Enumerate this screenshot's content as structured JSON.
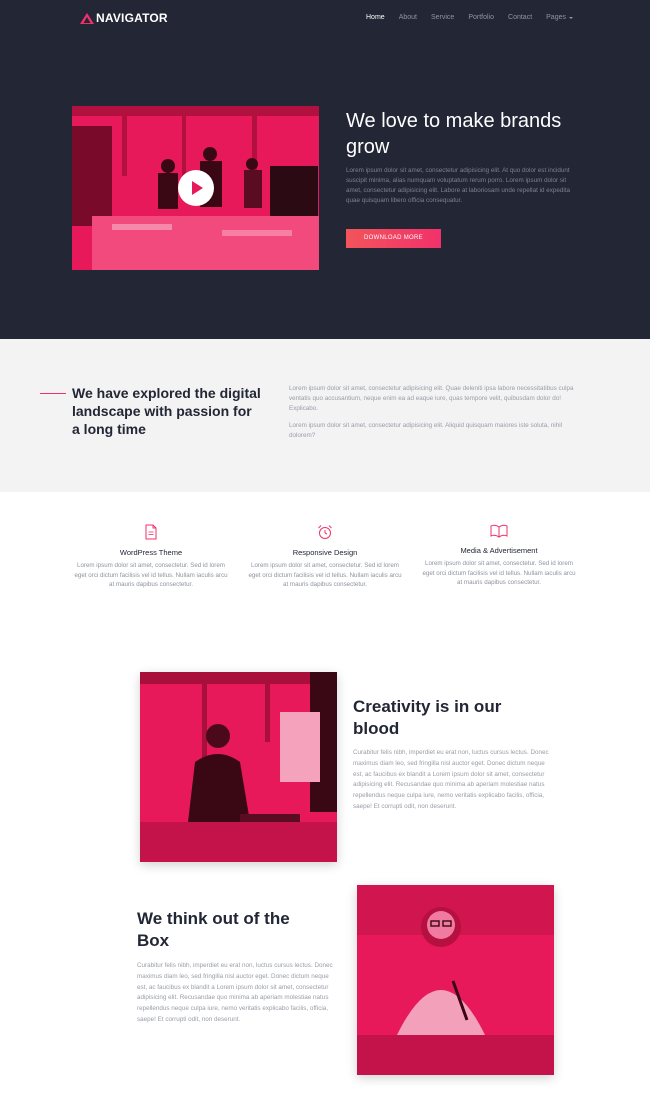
{
  "brand": {
    "name": "NAVIGATOR",
    "accent": "#f2316a",
    "dark_bg": "#222635"
  },
  "nav": {
    "items": [
      {
        "label": "Home",
        "active": true
      },
      {
        "label": "About",
        "active": false
      },
      {
        "label": "Service",
        "active": false
      },
      {
        "label": "Portfolio",
        "active": false
      },
      {
        "label": "Contact",
        "active": false
      },
      {
        "label": "Pages",
        "active": false,
        "has_dropdown": true
      }
    ]
  },
  "hero": {
    "title": "We love to make brands grow",
    "text": "Lorem ipsum dolor sit amet, consectetur adipisicing elit. At quo dolor est incidunt suscipit minima, alias numquam voluptatum rerum porro. Lorem ipsum dolor sit amet, consectetur adipisicing elit. Labore at laboriosam unde repellat id expedita quae quisquam libero officia consequatur.",
    "button": "DOWNLOAD MORE"
  },
  "explore": {
    "title": "We have explored the digital landscape with passion for a long time",
    "paragraphs": [
      "Lorem ipsum dolor sit amet, consectetur adipisicing elit. Quae deleniti ipsa labore necessitatibus culpa ventatis quo accusantium, neque enim ea ad eaque iure, quas tempore velit, quibusdam dolor do! Explicabo.",
      "Lorem ipsum dolor sit amet, consectetur adipisicing elit. Aliquid quisquam maiores iste soluta, nihil dolorem?"
    ]
  },
  "features": [
    {
      "icon": "document-icon",
      "title": "WordPress Theme",
      "text": "Lorem ipsum dolor sit amet, consectetur. Sed id lorem eget orci dictum facilisis vel id tellus. Nullam iaculis arcu at mauris dapibus consectetur."
    },
    {
      "icon": "alarm-clock-icon",
      "title": "Responsive Design",
      "text": "Lorem ipsum dolor sit amet, consectetur. Sed id lorem eget orci dictum facilisis vel id tellus. Nullam iaculis arcu at mauris dapibus consectetur."
    },
    {
      "icon": "open-book-icon",
      "title": "Media & Advertisement",
      "text": "Lorem ipsum dolor sit amet, consectetur. Sed id lorem eget orci dictum facilisis vel id tellus. Nullam iaculis arcu at mauris dapibus consectetur."
    }
  ],
  "blocks": [
    {
      "title": "Creativity is in our blood",
      "text": "Curabitur felis nibh, imperdiet eu erat non, luctus cursus lectus. Donec maximus diam leo, sed fringilla nisl auctor eget. Donec dictum neque est, ac faucibus ex blandit a Lorem ipsum dolor sit amet, consectetur adipisicing elit. Recusandae quo minima ab aperiam molestiae natus repellendus neque culpa iure, nemo veritatis explicabo facilis, officia, saepe! Et corrupti odit, non deserunt."
    },
    {
      "title": "We think out of the Box",
      "text": "Curabitur felis nibh, imperdiet eu erat non, luctus cursus lectus. Donec maximus diam leo, sed fringilla nisl auctor eget. Donec dictum neque est, ac faucibus ex blandit a Lorem ipsum dolor sit amet, consectetur adipisicing elit. Recusandae quo minima ab aperiam molestiae natus repellendus neque culpa iure, nemo veritatis explicabo facilis, officia, saepe! Et corrupti odit, non deserunt."
    }
  ]
}
